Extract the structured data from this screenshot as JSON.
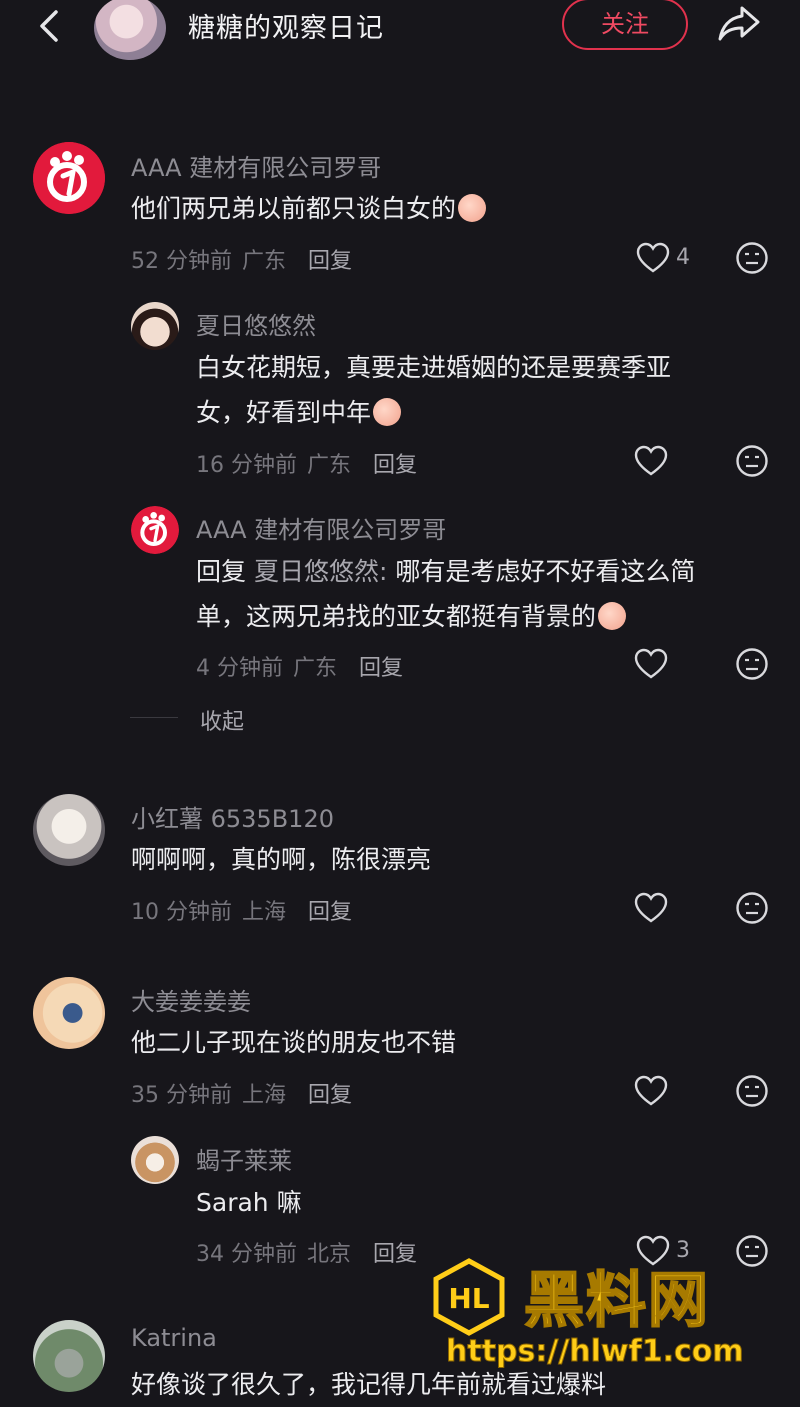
{
  "header": {
    "title": "糖糖的观察日记",
    "follow_label": "关注"
  },
  "comments": [
    {
      "user": "AAA 建材有限公司罗哥",
      "text": "他们两兄弟以前都只谈白女的",
      "time": "52 分钟前",
      "location": "广东",
      "reply_label": "回复",
      "likes": "4",
      "replies": [
        {
          "user": "夏日悠悠然",
          "text_line1": "白女花期短，真要走进婚姻的还是要赛季亚",
          "text_line2": "女，好看到中年",
          "time": "16 分钟前",
          "location": "广东",
          "reply_label": "回复"
        },
        {
          "user": "AAA 建材有限公司罗哥",
          "reply_prefix": "回复",
          "reply_target": "夏日悠悠然:",
          "text_line1": "哪有是考虑好不好看这么简",
          "text_line2": "单，这两兄弟找的亚女都挺有背景的",
          "time": "4 分钟前",
          "location": "广东",
          "reply_label": "回复"
        }
      ],
      "collapse_label": "收起"
    },
    {
      "user": "小红薯 6535B120",
      "text": "啊啊啊，真的啊，陈很漂亮",
      "time": "10 分钟前",
      "location": "上海",
      "reply_label": "回复"
    },
    {
      "user": "大姜姜姜姜",
      "text": "他二儿子现在谈的朋友也不错",
      "time": "35 分钟前",
      "location": "上海",
      "reply_label": "回复",
      "replies": [
        {
          "user": "蝎子莱莱",
          "text": "Sarah 嘛",
          "time": "34 分钟前",
          "location": "北京",
          "reply_label": "回复",
          "likes": "3"
        }
      ]
    },
    {
      "user": "Katrina",
      "text": "好像谈了很久了，我记得几年前就看过爆料"
    }
  ],
  "watermark": {
    "title": "黑料网",
    "url": "https://hlwf1.com"
  },
  "colors": {
    "background": "#17161b",
    "accent": "#e1324d",
    "watermark": "#ffcd18"
  }
}
